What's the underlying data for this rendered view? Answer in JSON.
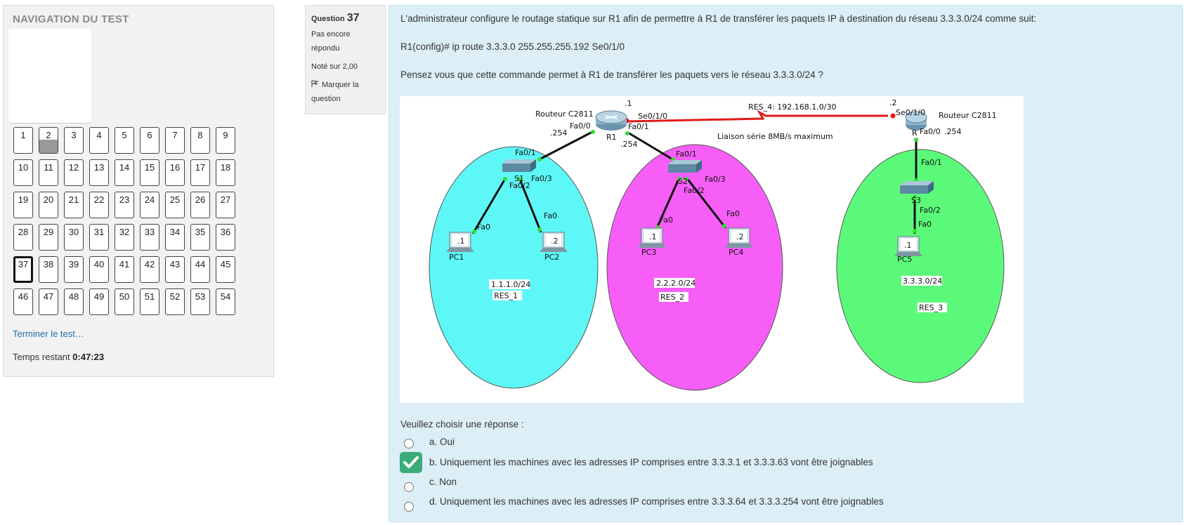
{
  "nav": {
    "title": "NAVIGATION DU TEST",
    "questions": [
      "1",
      "2",
      "3",
      "4",
      "5",
      "6",
      "7",
      "8",
      "9",
      "10",
      "11",
      "12",
      "13",
      "14",
      "15",
      "16",
      "17",
      "18",
      "19",
      "20",
      "21",
      "22",
      "23",
      "24",
      "25",
      "26",
      "27",
      "28",
      "29",
      "30",
      "31",
      "32",
      "33",
      "34",
      "35",
      "36",
      "37",
      "38",
      "39",
      "40",
      "41",
      "42",
      "43",
      "44",
      "45",
      "46",
      "47",
      "48",
      "49",
      "50",
      "51",
      "52",
      "53",
      "54"
    ],
    "answered": [
      "2"
    ],
    "current": "37",
    "finish_link": "Terminer le test…",
    "timer_label": "Temps restant",
    "timer_value": "0:47:23"
  },
  "qinfo": {
    "question_label": "Question",
    "question_number": "37",
    "status": "Pas encore répondu",
    "grade": "Noté sur 2,00",
    "flag": "Marquer la question"
  },
  "question": {
    "text1": "L'administrateur configure le routage statique sur R1 afin de permettre à R1 de transférer les paquets IP à destination du réseau 3.3.3.0/24 comme suit:",
    "command": "R1(config)# ip route 3.3.3.0 255.255.255.192 Se0/1/0",
    "text2": "Pensez vous que cette commande permet à R1 de transférer les paquets vers le réseau 3.3.3.0/24 ?",
    "prompt": "Veuillez choisir une réponse :",
    "options": [
      {
        "label": "a. Oui",
        "checked": false
      },
      {
        "label": "b. Uniquement les machines avec les adresses IP comprises entre 3.3.3.1 et 3.3.3.63 vont être joignables",
        "checked": true
      },
      {
        "label": "c. Non",
        "checked": false
      },
      {
        "label": "d. Uniquement les machines avec les adresses IP comprises entre 3.3.3.64 et 3.3.3.254 vont être joignables",
        "checked": false
      }
    ]
  },
  "diagram": {
    "colors": {
      "res1": "#5ef7f7",
      "res2": "#f75ef7",
      "res3": "#5cfa7a",
      "serial": "#e11a1a"
    },
    "labels": {
      "router_left_model": "Routeur C2811",
      "router_right_model": "Routeur C2811",
      "r1": "R1",
      "r1_top": ".1",
      "r1_fa00": "Fa0/0",
      "r1_fa00_ip": ".254",
      "r1_se": "Se0/1/0",
      "r1_fa01": "Fa0/1",
      "r1_fa01_ip": ".254",
      "serial_net": "RES_4: 192.168.1.0/30",
      "serial_note": "Liaison série 8MB/s maximum",
      "r2_top": ".2",
      "r2_se": "Se0/1/0",
      "r2": "R",
      "r2_fa00": "Fa0/0",
      "r2_fa00_ip": ".254",
      "s1": "S1",
      "s1_fa01": "Fa0/1",
      "s1_fa02": "Fa0/2",
      "s1_fa03": "Fa0/3",
      "s2": "S2",
      "s2_fa01": "Fa0/1",
      "s2_fa02": "Fa0/2",
      "s2_fa03": "Fa0/3",
      "s3": "S3",
      "s3_fa01": "Fa0/1",
      "s3_fa02": "Fa0/2",
      "pc1": "PC1",
      "pc1_ip": ".1",
      "pc1_fa": "Fa0",
      "pc2": "PC2",
      "pc2_ip": ".2",
      "pc2_fa": "Fa0",
      "pc3": "PC3",
      "pc3_ip": ".1",
      "pc3_fa": "Fa0",
      "pc4": "PC4",
      "pc4_ip": ".2",
      "pc4_fa": "Fa0",
      "pc5": "PC5",
      "pc5_ip": ".1",
      "pc5_fa": "Fa0",
      "net1": "1.1.1.0/24",
      "res1": "RES_1",
      "net2": "2.2.2.0/24",
      "res2": "RES_2",
      "net3": "3.3.3.0/24",
      "res3": "RES_3"
    }
  }
}
